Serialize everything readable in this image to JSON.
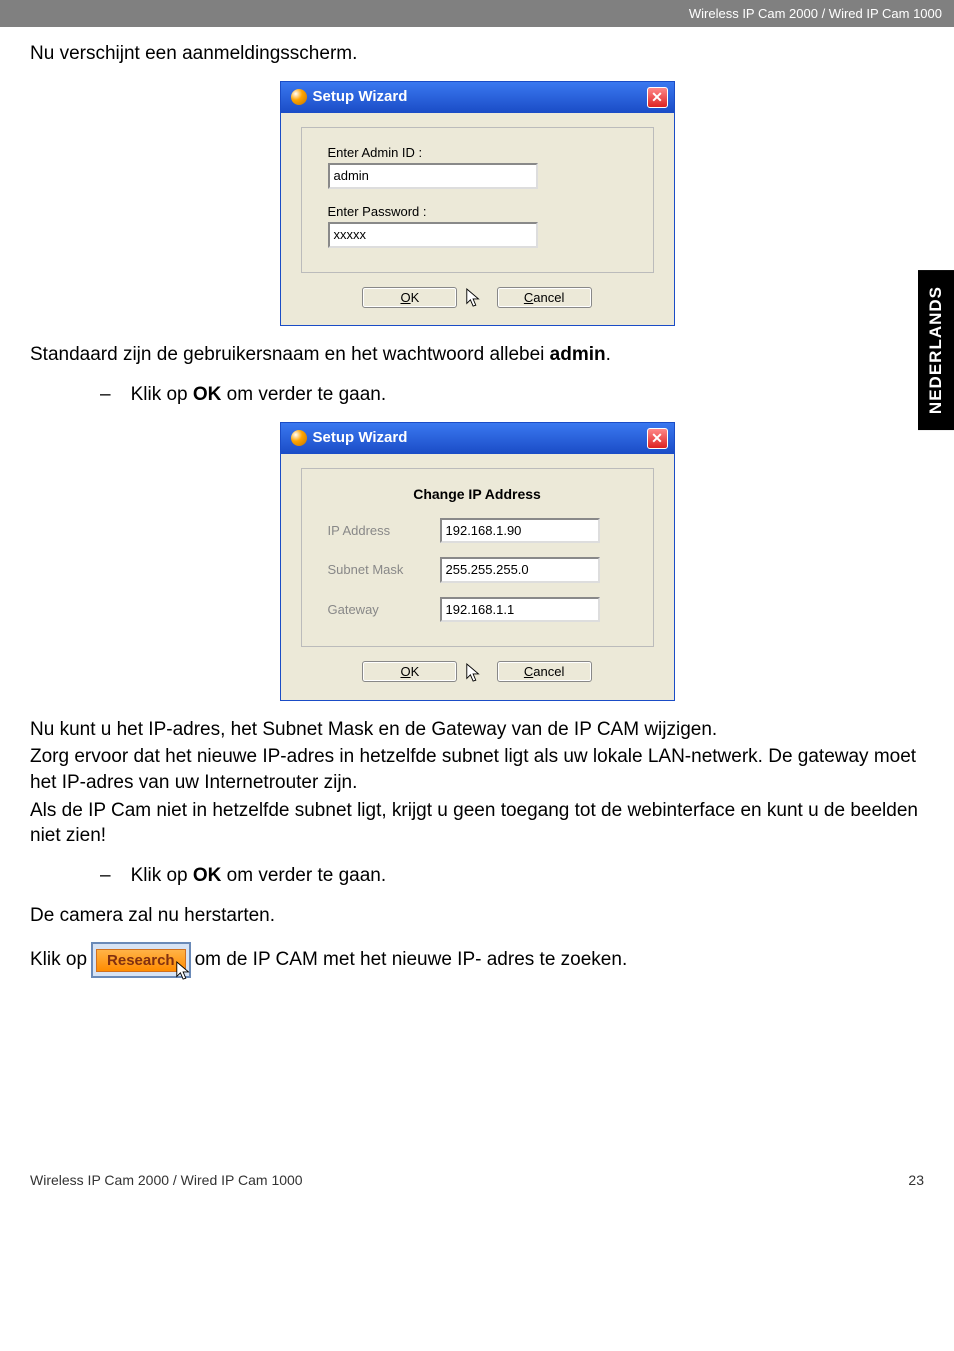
{
  "header": {
    "product_line": "Wireless IP Cam 2000 / Wired IP Cam 1000"
  },
  "side_tab": "NEDERLANDS",
  "body": {
    "intro": "Nu verschijnt een aanmeldingsscherm.",
    "after_login": {
      "pre": "Standaard zijn de gebruikersnaam en het wachtwoord allebei ",
      "bold": "admin",
      "post": "."
    },
    "bullet1": {
      "dash": "–",
      "pre": "Klik op ",
      "bold": "OK",
      "post": " om verder te gaan."
    },
    "para_ip1": "Nu kunt u het IP-adres, het Subnet Mask en de Gateway van de IP CAM wijzigen.",
    "para_ip2": "Zorg ervoor dat het nieuwe IP-adres in hetzelfde subnet ligt als uw lokale LAN-netwerk. De gateway moet het IP-adres van uw Internetrouter zijn.",
    "para_ip3": "Als de IP Cam niet in hetzelfde subnet ligt, krijgt u geen toegang tot de webinterface en kunt u de beelden niet zien!",
    "bullet2": {
      "dash": "–",
      "pre": "Klik op ",
      "bold": "OK",
      "post": " om verder te gaan."
    },
    "restart": "De camera zal nu herstarten.",
    "research_line": {
      "pre": "Klik op ",
      "post": " om de IP CAM met het nieuwe IP- adres te zoeken."
    }
  },
  "dialog1": {
    "title": "Setup Wizard",
    "admin_label": "Enter Admin ID :",
    "admin_value": "admin",
    "pw_label": "Enter Password :",
    "pw_value": "xxxxx",
    "ok": "OK",
    "cancel": "Cancel"
  },
  "dialog2": {
    "title": "Setup Wizard",
    "heading": "Change IP Address",
    "ip_label": "IP Address",
    "ip_value": "192.168.1.90",
    "mask_label": "Subnet Mask",
    "mask_value": "255.255.255.0",
    "gw_label": "Gateway",
    "gw_value": "192.168.1.1",
    "ok": "OK",
    "cancel": "Cancel"
  },
  "research_button": "Research",
  "footer": {
    "left": "Wireless IP Cam 2000 / Wired IP Cam 1000",
    "page": "23"
  }
}
